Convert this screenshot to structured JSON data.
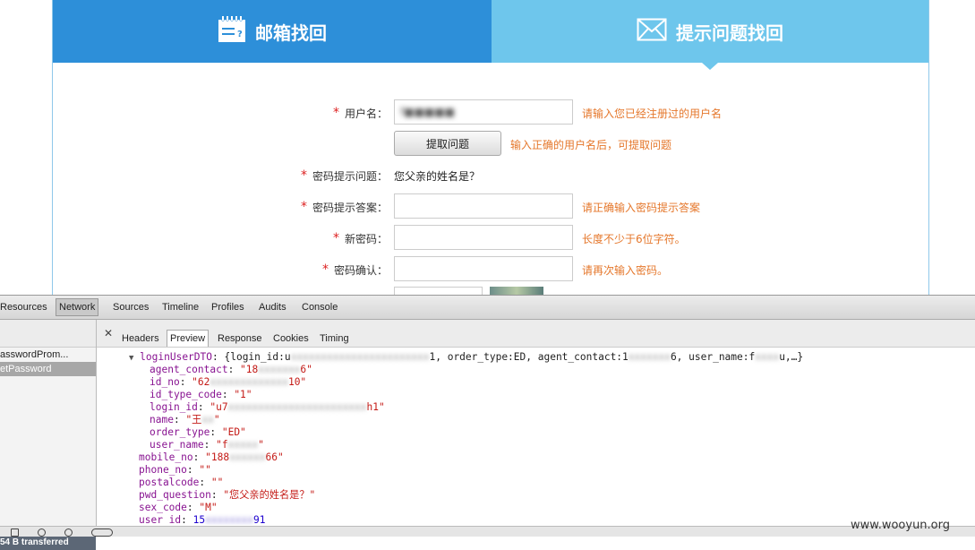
{
  "tabs": {
    "email_label": "邮箱找回",
    "question_label": "提示问题找回"
  },
  "form": {
    "username": {
      "label": "用户名：",
      "value": "f■■■■■",
      "hint": "请输入您已经注册过的用户名"
    },
    "fetch_button": {
      "label": "提取问题",
      "hint": "输入正确的用户名后，可提取问题"
    },
    "question": {
      "label": "密码提示问题：",
      "value": "您父亲的姓名是？"
    },
    "answer": {
      "label": "密码提示答案：",
      "hint": "请正确输入密码提示答案"
    },
    "new_password": {
      "label": "新密码：",
      "hint": "长度不少于6位字符。"
    },
    "confirm_password": {
      "label": "密码确认：",
      "hint": "请再次输入密码。"
    },
    "required_mark": "*"
  },
  "devtools": {
    "panels": [
      "Resources",
      "Network",
      "Sources",
      "Timeline",
      "Profiles",
      "Audits",
      "Console"
    ],
    "active_panel": "Network",
    "requests": [
      "asswordProm...",
      "etPassword"
    ],
    "transferred": "54 B transferred",
    "subtabs": [
      "Headers",
      "Preview",
      "Response",
      "Cookies",
      "Timing"
    ],
    "active_subtab": "Preview",
    "preview_lines": {
      "login_dto_key": "loginUserDTO",
      "login_dto_summary_a": "{login_id:u",
      "login_dto_summary_b": "1, order_type:ED, agent_contact:1",
      "login_dto_summary_c": "6, user_name:f",
      "login_dto_summary_d": "u,…}",
      "agent_contact_key": "agent_contact",
      "agent_contact_a": "\"18",
      "agent_contact_b": "6\"",
      "id_no_key": "id_no",
      "id_no_a": "\"62",
      "id_no_b": "10\"",
      "id_type_code_key": "id_type_code",
      "id_type_code_val": "\"1\"",
      "login_id_key": "login_id",
      "login_id_a": "\"u7",
      "login_id_b": "h1\"",
      "name_key": "name",
      "name_val": "\"王",
      "name_end": "\"",
      "order_type_key": "order_type",
      "order_type_val": "\"ED\"",
      "user_name_key": "user_name",
      "user_name_a": "\"f",
      "user_name_b": "\"",
      "mobile_no_key": "mobile_no",
      "mobile_no_a": "\"188",
      "mobile_no_b": "66\"",
      "phone_no_key": "phone_no",
      "phone_no_val": "\"\"",
      "postalcode_key": "postalcode",
      "postalcode_val": "\"\"",
      "pwd_question_key": "pwd_question",
      "pwd_question_val": "\"您父亲的姓名是？\"",
      "sex_code_key": "sex_code",
      "sex_code_val": "\"M\"",
      "user_id_key": "user_id",
      "user_id_a": "15",
      "user_id_b": "91"
    }
  },
  "watermark": "www.wooyun.org",
  "colors": {
    "tab_email_bg": "#2d8fd9",
    "tab_question_bg": "#6ec6ec",
    "hint": "#e5772b",
    "required": "#dd2222"
  }
}
